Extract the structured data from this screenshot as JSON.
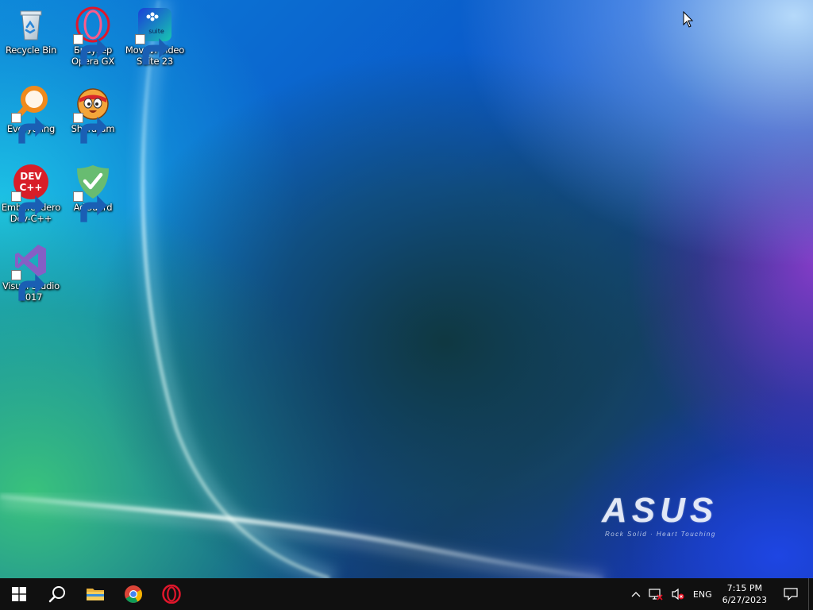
{
  "desktop": {
    "icons": [
      {
        "id": "recycle-bin",
        "label": "Recycle Bin",
        "icon": "recycle-bin-icon",
        "shortcut": false
      },
      {
        "id": "opera-gx",
        "label": "Браузер\nOpera GX",
        "icon": "opera-gx-icon",
        "shortcut": true
      },
      {
        "id": "movavi",
        "label": "Movavi Video\nSuite 23",
        "icon": "movavi-suite-icon",
        "shortcut": true
      },
      {
        "id": "everything",
        "label": "Everything",
        "icon": "everything-search-icon",
        "shortcut": true
      },
      {
        "id": "shararam",
        "label": "Shararam",
        "icon": "shararam-icon",
        "shortcut": true
      },
      {
        "id": "devcpp",
        "label": "Embarcadero\nDev-C++",
        "icon": "dev-cpp-icon",
        "shortcut": true
      },
      {
        "id": "adguard",
        "label": "AdGuard",
        "icon": "adguard-icon",
        "shortcut": true
      },
      {
        "id": "visual-studio",
        "label": "Visual Studio\n2017",
        "icon": "visual-studio-icon",
        "shortcut": true
      }
    ],
    "movavi_badge": "suite",
    "devcpp_badge_line1": "DEV",
    "devcpp_badge_line2": "C++"
  },
  "wallpaper": {
    "brand": "ASUS",
    "tagline": "Rock Solid · Heart Touching"
  },
  "taskbar": {
    "pinned": [
      {
        "name": "start-button",
        "icon": "windows-logo-icon"
      },
      {
        "name": "search-button",
        "icon": "search-icon"
      },
      {
        "name": "file-explorer-button",
        "icon": "folder-icon"
      },
      {
        "name": "chrome-button",
        "icon": "chrome-icon"
      },
      {
        "name": "opera-button",
        "icon": "opera-icon"
      }
    ],
    "tray": {
      "language": "ENG",
      "time": "7:15 PM",
      "date": "6/27/2023",
      "network_status": "disconnected",
      "volume_status": "muted"
    }
  },
  "colors": {
    "taskbar": "#101010",
    "opera_red": "#e0162b",
    "adguard_green": "#68bc71",
    "vs_purple": "#865fc5",
    "devcpp_red": "#d81e28",
    "everything_orange": "#f08a1c"
  }
}
